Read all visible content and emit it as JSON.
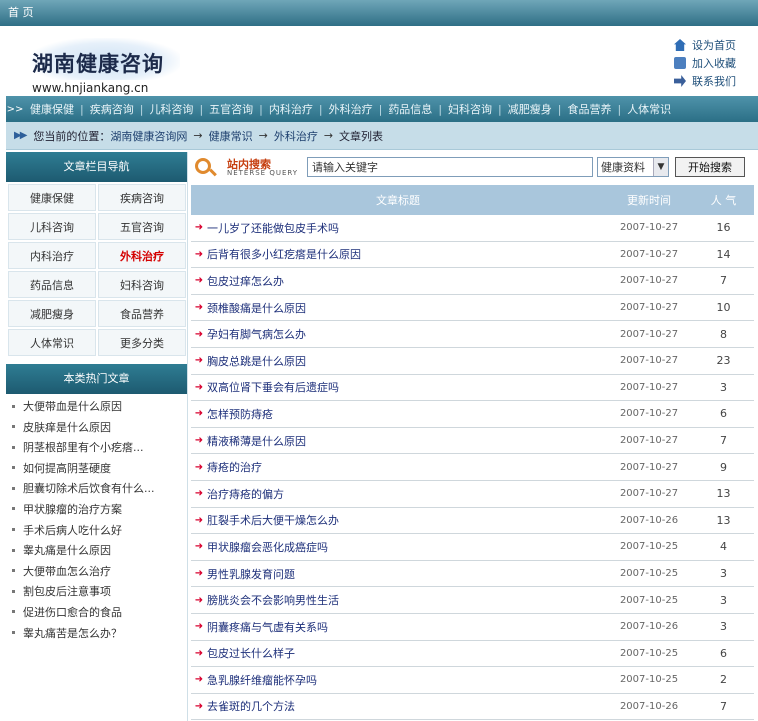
{
  "topbar": {
    "title": "首 页"
  },
  "header": {
    "logo_text": "湖南健康咨询",
    "logo_url": "www.hnjiankang.cn",
    "quick_links": [
      {
        "label": "设为首页",
        "icon": "home-icon",
        "color": "#2f6db5"
      },
      {
        "label": "加入收藏",
        "icon": "favorite-icon",
        "color": "#4c7fbf"
      },
      {
        "label": "联系我们",
        "icon": "contact-icon",
        "color": "#3a5f9a"
      }
    ]
  },
  "nav": {
    "items": [
      "健康保健",
      "疾病咨询",
      "儿科咨询",
      "五官咨询",
      "内科治疗",
      "外科治疗",
      "药品信息",
      "妇科咨询",
      "减肥瘦身",
      "食品营养",
      "人体常识"
    ]
  },
  "breadcrumb": {
    "prefix": "您当前的位置：",
    "items": [
      "湖南健康咨询网",
      "健康常识",
      "外科治疗",
      "文章列表"
    ],
    "arrow": "→"
  },
  "sidebar": {
    "nav_title": "文章栏目导航",
    "categories": [
      {
        "label": "健康保健",
        "active": false
      },
      {
        "label": "疾病咨询",
        "active": false
      },
      {
        "label": "儿科咨询",
        "active": false
      },
      {
        "label": "五官咨询",
        "active": false
      },
      {
        "label": "内科治疗",
        "active": false
      },
      {
        "label": "外科治疗",
        "active": true
      },
      {
        "label": "药品信息",
        "active": false
      },
      {
        "label": "妇科咨询",
        "active": false
      },
      {
        "label": "减肥瘦身",
        "active": false
      },
      {
        "label": "食品营养",
        "active": false
      },
      {
        "label": "人体常识",
        "active": false
      },
      {
        "label": "更多分类",
        "active": false
      }
    ],
    "hot_title": "本类热门文章",
    "hot_articles": [
      "大便带血是什么原因",
      "皮肤痒是什么原因",
      "阴茎根部里有个小疙瘩...",
      "如何提高阴茎硬度",
      "胆囊切除术后饮食有什么...",
      "甲状腺瘤的治疗方案",
      "手术后病人吃什么好",
      "睾丸痛是什么原因",
      "大便带血怎么治疗",
      "割包皮后注意事项",
      "促进伤口愈合的食品",
      "睾丸痛苦是怎么办？"
    ]
  },
  "search": {
    "logo_cn": "站内搜索",
    "logo_en": "NETERSE QUERY",
    "placeholder": "请输入关键字",
    "value": "请输入关键字",
    "select_value": "健康资料",
    "button_label": "开始搜索"
  },
  "table": {
    "headers": {
      "title": "文章标题",
      "date": "更新时间",
      "hits": "人 气"
    },
    "rows": [
      {
        "title": "一儿岁了还能做包皮手术吗",
        "date": "2007-10-27",
        "hits": "16"
      },
      {
        "title": "后背有很多小红疙瘩是什么原因",
        "date": "2007-10-27",
        "hits": "14"
      },
      {
        "title": "包皮过痒怎么办",
        "date": "2007-10-27",
        "hits": "7"
      },
      {
        "title": "颈椎酸痛是什么原因",
        "date": "2007-10-27",
        "hits": "10"
      },
      {
        "title": "孕妇有脚气病怎么办",
        "date": "2007-10-27",
        "hits": "8"
      },
      {
        "title": "胸皮总跳是什么原因",
        "date": "2007-10-27",
        "hits": "23"
      },
      {
        "title": "双高位肾下垂会有后遗症吗",
        "date": "2007-10-27",
        "hits": "3"
      },
      {
        "title": "怎样预防痔疮",
        "date": "2007-10-27",
        "hits": "6"
      },
      {
        "title": "精液稀薄是什么原因",
        "date": "2007-10-27",
        "hits": "7"
      },
      {
        "title": "痔疮的治疗",
        "date": "2007-10-27",
        "hits": "9"
      },
      {
        "title": "治疗痔疮的偏方",
        "date": "2007-10-27",
        "hits": "13"
      },
      {
        "title": "肛裂手术后大便干燥怎么办",
        "date": "2007-10-26",
        "hits": "13"
      },
      {
        "title": "甲状腺瘤会恶化成癌症吗",
        "date": "2007-10-25",
        "hits": "4"
      },
      {
        "title": "男性乳腺发育问题",
        "date": "2007-10-25",
        "hits": "3"
      },
      {
        "title": "膀胱炎会不会影响男性生活",
        "date": "2007-10-25",
        "hits": "3"
      },
      {
        "title": "阴囊疼痛与气虚有关系吗",
        "date": "2007-10-26",
        "hits": "3"
      },
      {
        "title": "包皮过长什么样子",
        "date": "2007-10-25",
        "hits": "6"
      },
      {
        "title": "急乳腺纤维瘤能怀孕吗",
        "date": "2007-10-25",
        "hits": "2"
      },
      {
        "title": "去雀斑的几个方法",
        "date": "2007-10-26",
        "hits": "7"
      }
    ]
  }
}
